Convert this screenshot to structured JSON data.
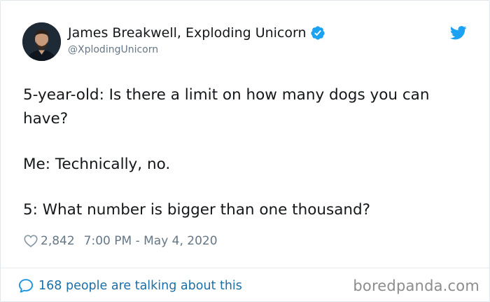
{
  "author": {
    "display_name": "James Breakwell, Exploding Unicorn",
    "handle": "@XplodingUnicorn",
    "verified": true
  },
  "tweet": {
    "lines": [
      "5-year-old: Is there a limit on how many dogs you can have?",
      "Me: Technically, no.",
      "5: What number is bigger than one thousand?"
    ],
    "likes": "2,842",
    "timestamp": "7:00 PM - May 4, 2020"
  },
  "footer": {
    "conversation_link": "168 people are talking about this",
    "watermark": "boredpanda.com"
  },
  "colors": {
    "twitter_blue": "#1da1f2",
    "link_blue": "#1b6fa8",
    "muted_gray": "#657786",
    "text_dark": "#14171a"
  },
  "icons": {
    "verified": "verified-badge-icon",
    "logo": "twitter-bird-icon",
    "like": "heart-icon",
    "reply": "speech-bubble-icon"
  }
}
